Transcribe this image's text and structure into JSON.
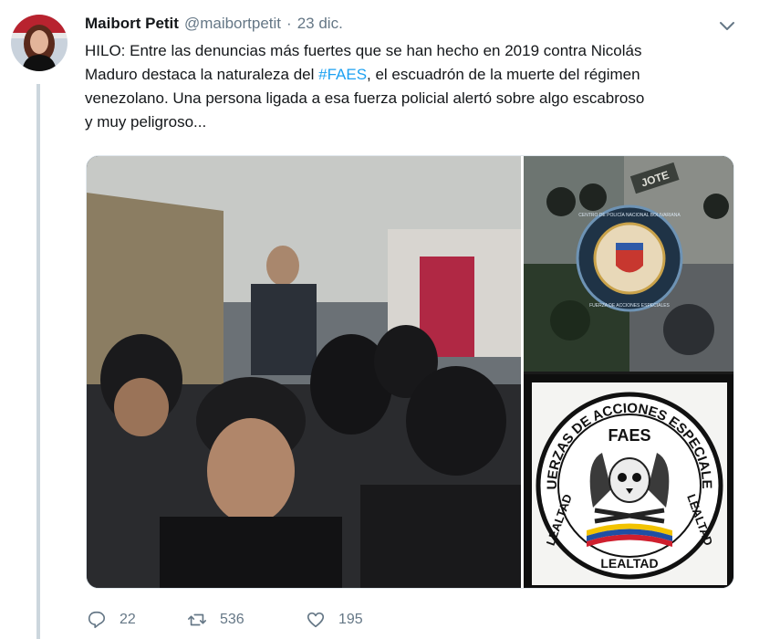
{
  "tweet": {
    "author_name": "Maibort Petit",
    "author_handle": "@maibortpetit",
    "separator": "·",
    "date": "23 dic.",
    "text_lines": [
      "HILO: Entre las denuncias más fuertes que se han hecho en 2019 contra Nicolás",
      "Maduro destaca la naturaleza del #FAES, el escuadrón de la muerte del régimen",
      "venezolano. Una persona ligada a esa fuerza policial alertó sobre algo escabroso",
      "y muy peligroso..."
    ],
    "hashtag": "#FAES"
  },
  "media": {
    "patch_lines": [
      "CENTRO DE POLICÍA NACIONAL BOLIVARIANA",
      "FUERZA DE ACCIONES ESPECIALES"
    ],
    "patch_label": "JOTE",
    "logo_arc_text": "FUERZAS DE ACCIONES ESPECIALES",
    "logo_center": "FAES",
    "logo_left": "LEALTAD",
    "logo_right": "LEALTAD",
    "logo_bottom": "LEALTAD"
  },
  "actions": {
    "replies": "22",
    "retweets": "536",
    "likes": "195"
  },
  "colors": {
    "text": "#14171a",
    "secondary": "#657786",
    "thread_line": "#ccd6dd",
    "link": "#1da1f2"
  }
}
